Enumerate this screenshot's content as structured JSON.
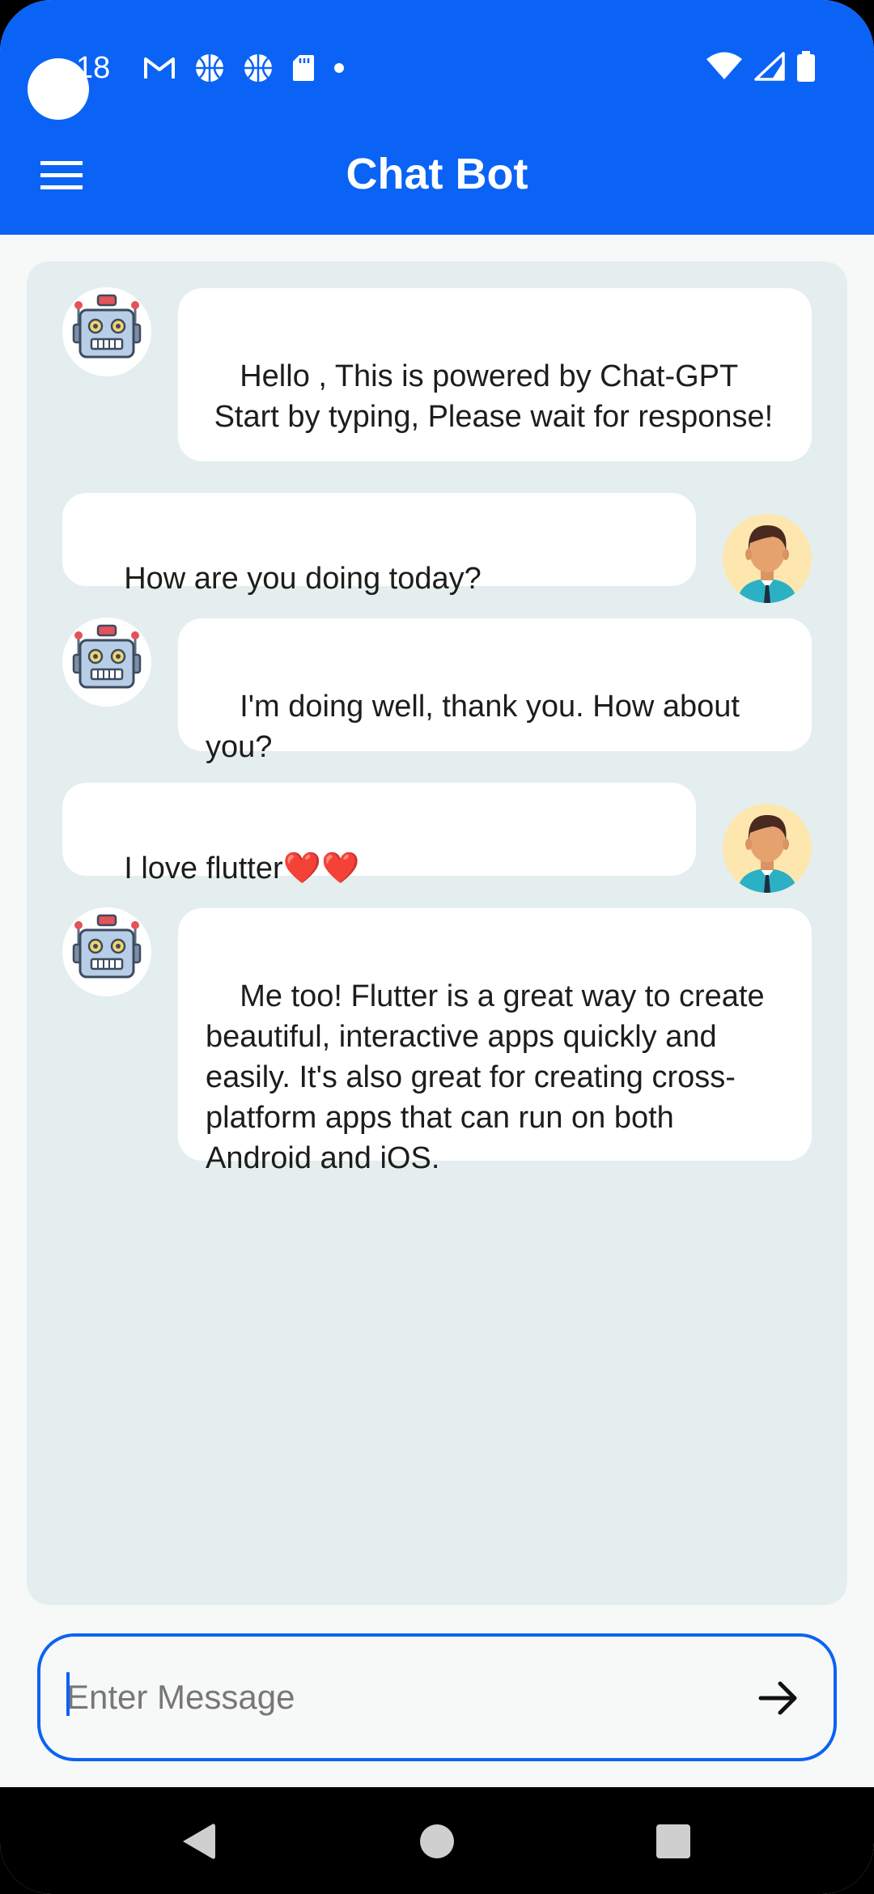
{
  "status_bar": {
    "time": "18",
    "icons_left": [
      "gmail-icon",
      "basketball-icon",
      "basketball-icon",
      "sd-card-icon",
      "dot-icon"
    ],
    "icons_right": [
      "wifi-icon",
      "signal-icon",
      "battery-icon"
    ]
  },
  "app_bar": {
    "title": "Chat Bot",
    "menu_icon": "hamburger-menu-icon",
    "background": "#0a63f5"
  },
  "messages": [
    {
      "sender": "bot",
      "text": "Hello , This is powered by Chat-GPT\n Start by typing, Please wait for response!"
    },
    {
      "sender": "user",
      "text": "How are you doing today?"
    },
    {
      "sender": "bot",
      "text": "I'm doing well, thank you. How about you?"
    },
    {
      "sender": "user",
      "text": "I love flutter❤️❤️"
    },
    {
      "sender": "bot",
      "text": "Me too! Flutter is a great way to create beautiful, interactive apps quickly and easily. It's also great for creating cross-platform apps that can run on both Android and iOS."
    }
  ],
  "input": {
    "placeholder": "Enter Message",
    "value": "",
    "send_icon": "arrow-right-icon"
  },
  "nav_bar": {
    "icons": [
      "back-triangle-icon",
      "home-circle-icon",
      "recents-square-icon"
    ]
  }
}
